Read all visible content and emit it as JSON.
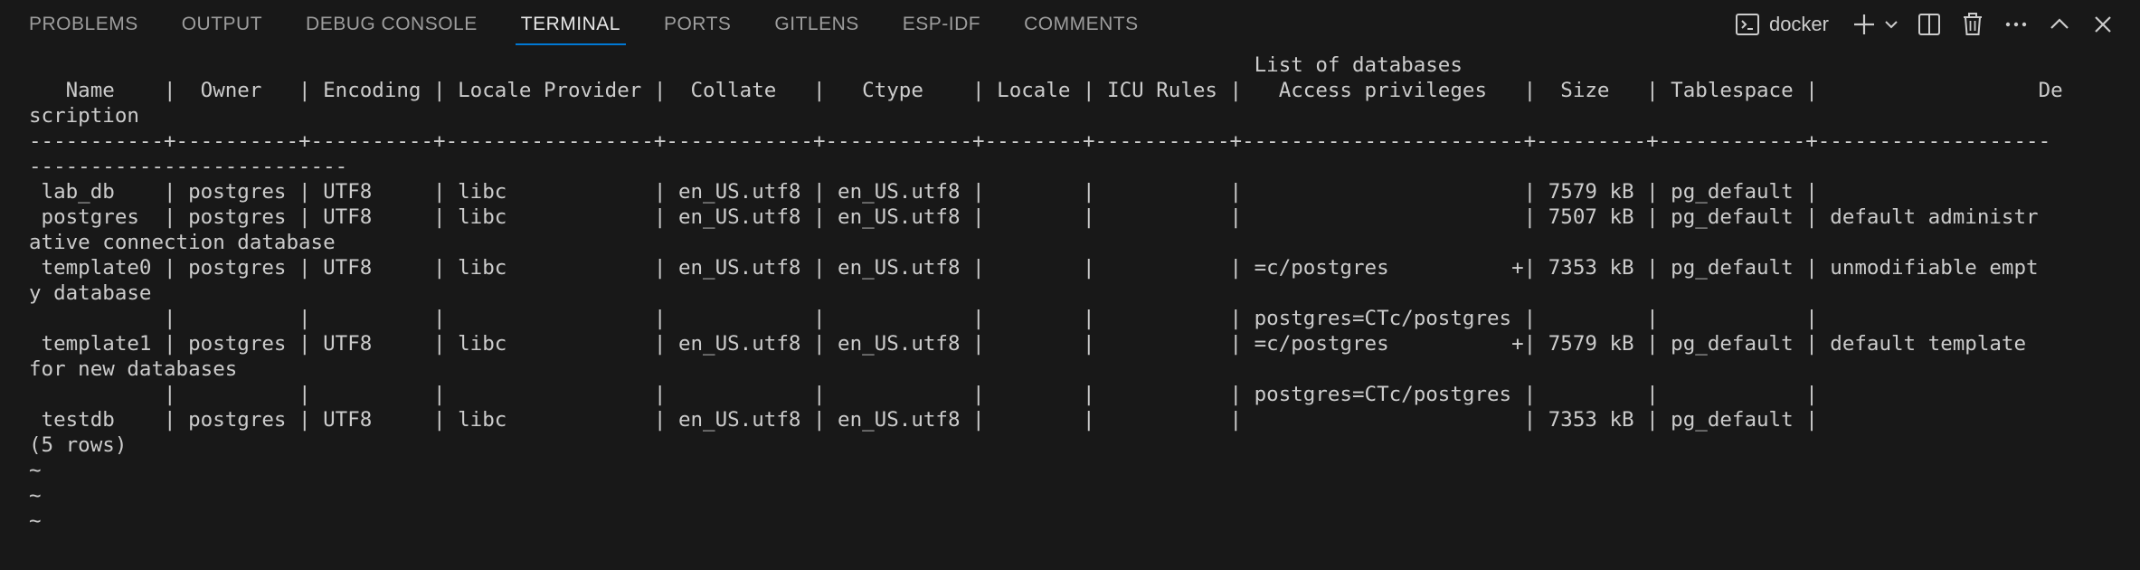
{
  "tabs": [
    {
      "label": "PROBLEMS",
      "active": false
    },
    {
      "label": "OUTPUT",
      "active": false
    },
    {
      "label": "DEBUG CONSOLE",
      "active": false
    },
    {
      "label": "TERMINAL",
      "active": true
    },
    {
      "label": "PORTS",
      "active": false
    },
    {
      "label": "GITLENS",
      "active": false
    },
    {
      "label": "ESP-IDF",
      "active": false
    },
    {
      "label": "COMMENTS",
      "active": false
    }
  ],
  "terminal_instance": {
    "label": "docker",
    "icon": "terminal-icon"
  },
  "action_icons": [
    "new-terminal-icon",
    "dropdown-chevron-icon",
    "split-terminal-icon",
    "kill-terminal-icon",
    "more-actions-icon",
    "maximize-panel-icon",
    "close-panel-icon"
  ],
  "colors": {
    "background": "#181818",
    "text": "#cccccc",
    "active_tab_underline": "#0078d4"
  },
  "terminal": {
    "lines": [
      "                                                                                                    List of databases",
      "   Name    |  Owner   | Encoding | Locale Provider |  Collate   |   Ctype    | Locale | ICU Rules |   Access privileges   |  Size   | Tablespace |                  De",
      "scription",
      "-----------+----------+----------+-----------------+------------+------------+--------+-----------+-----------------------+---------+------------+-------------------",
      "--------------------------",
      " lab_db    | postgres | UTF8     | libc            | en_US.utf8 | en_US.utf8 |        |           |                       | 7579 kB | pg_default |",
      " postgres  | postgres | UTF8     | libc            | en_US.utf8 | en_US.utf8 |        |           |                       | 7507 kB | pg_default | default administr",
      "ative connection database",
      " template0 | postgres | UTF8     | libc            | en_US.utf8 | en_US.utf8 |        |           | =c/postgres          +| 7353 kB | pg_default | unmodifiable empt",
      "y database",
      "           |          |          |                 |            |            |        |           | postgres=CTc/postgres |         |            |",
      " template1 | postgres | UTF8     | libc            | en_US.utf8 | en_US.utf8 |        |           | =c/postgres          +| 7579 kB | pg_default | default template",
      "for new databases",
      "           |          |          |                 |            |            |        |           | postgres=CTc/postgres |         |            |",
      " testdb    | postgres | UTF8     | libc            | en_US.utf8 | en_US.utf8 |        |           |                       | 7353 kB | pg_default |",
      "(5 rows)",
      "",
      "~",
      "~",
      "~"
    ]
  }
}
